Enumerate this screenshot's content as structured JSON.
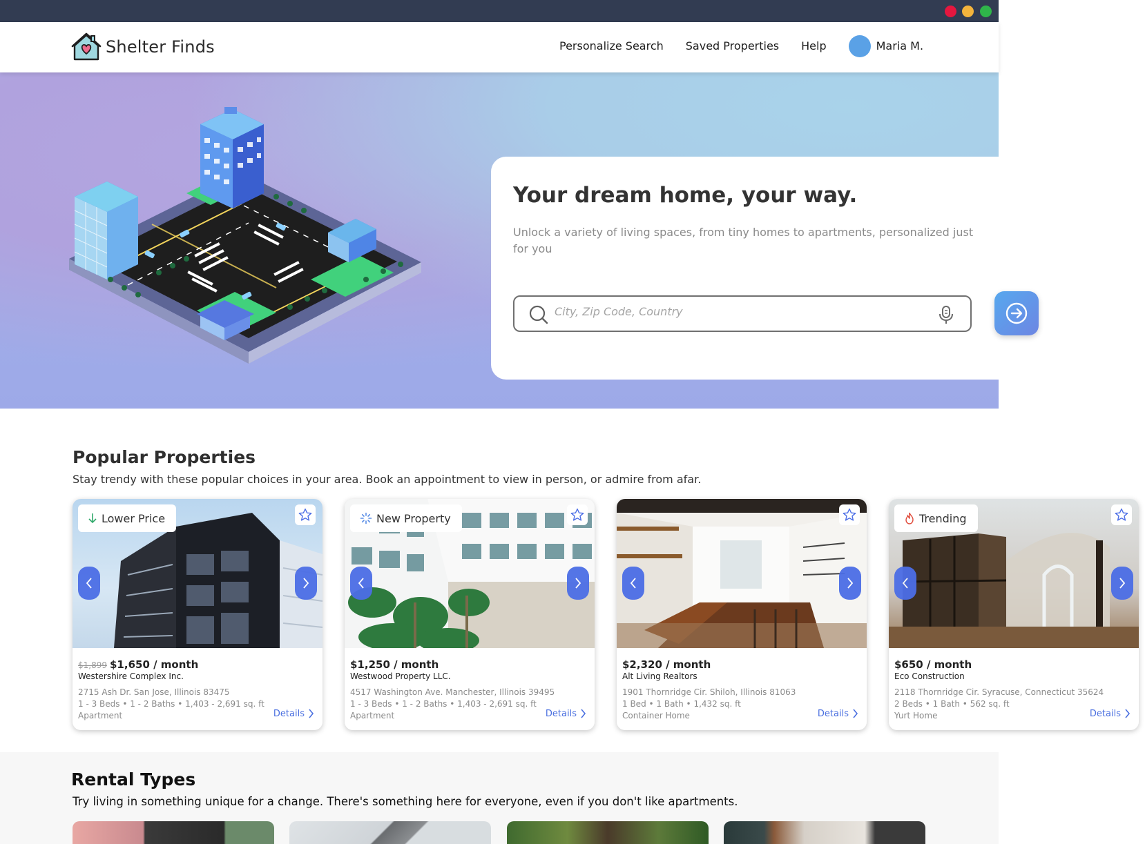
{
  "brand": {
    "name": "Shelter Finds"
  },
  "nav": {
    "links": [
      "Personalize Search",
      "Saved Properties",
      "Help"
    ],
    "user_name": "Maria M."
  },
  "hero": {
    "title": "Your dream home, your way.",
    "subtitle": "Unlock a variety of living spaces, from tiny homes to apartments, personalized just for you",
    "search_placeholder": "City, Zip Code, Country"
  },
  "popular": {
    "title": "Popular Properties",
    "subtitle": "Stay trendy with these popular choices in your area. Book an appointment to view in person, or admire from afar.",
    "details_label": "Details",
    "cards": [
      {
        "badge": "Lower Price",
        "old_price": "$1,899",
        "price": "$1,650 / month",
        "company": "Westershire Complex Inc.",
        "address": "2715 Ash Dr. San Jose, Illinois 83475",
        "specs": "1 - 3 Beds • 1 - 2 Baths • 1,403 - 2,691 sq. ft",
        "type": "Apartment"
      },
      {
        "badge": "New Property",
        "old_price": "",
        "price": "$1,250 / month",
        "company": "Westwood Property LLC.",
        "address": "4517 Washington Ave. Manchester, Illinois 39495",
        "specs": "1 - 3 Beds • 1 - 2 Baths • 1,403 - 2,691 sq. ft",
        "type": "Apartment"
      },
      {
        "badge": "",
        "old_price": "",
        "price": "$2,320 / month",
        "company": "Alt Living Realtors",
        "address": "1901 Thornridge Cir. Shiloh, Illinois 81063",
        "specs": "1 Bed • 1 Bath • 1,432 sq. ft",
        "type": "Container Home"
      },
      {
        "badge": "Trending",
        "old_price": "",
        "price": "$650 / month",
        "company": "Eco Construction",
        "address": "2118 Thornridge Cir. Syracuse, Connecticut 35624",
        "specs": "2 Beds • 1 Bath • 562 sq. ft",
        "type": "Yurt Home"
      }
    ]
  },
  "rental": {
    "title": "Rental Types",
    "subtitle": "Try living in something unique for a change. There's something here for everyone, even if you don't like apartments."
  },
  "colors": {
    "accent": "#4c6ee6",
    "window_bar": "#323c52",
    "avatar": "#5aa1e6",
    "link": "#4a6fe0"
  }
}
